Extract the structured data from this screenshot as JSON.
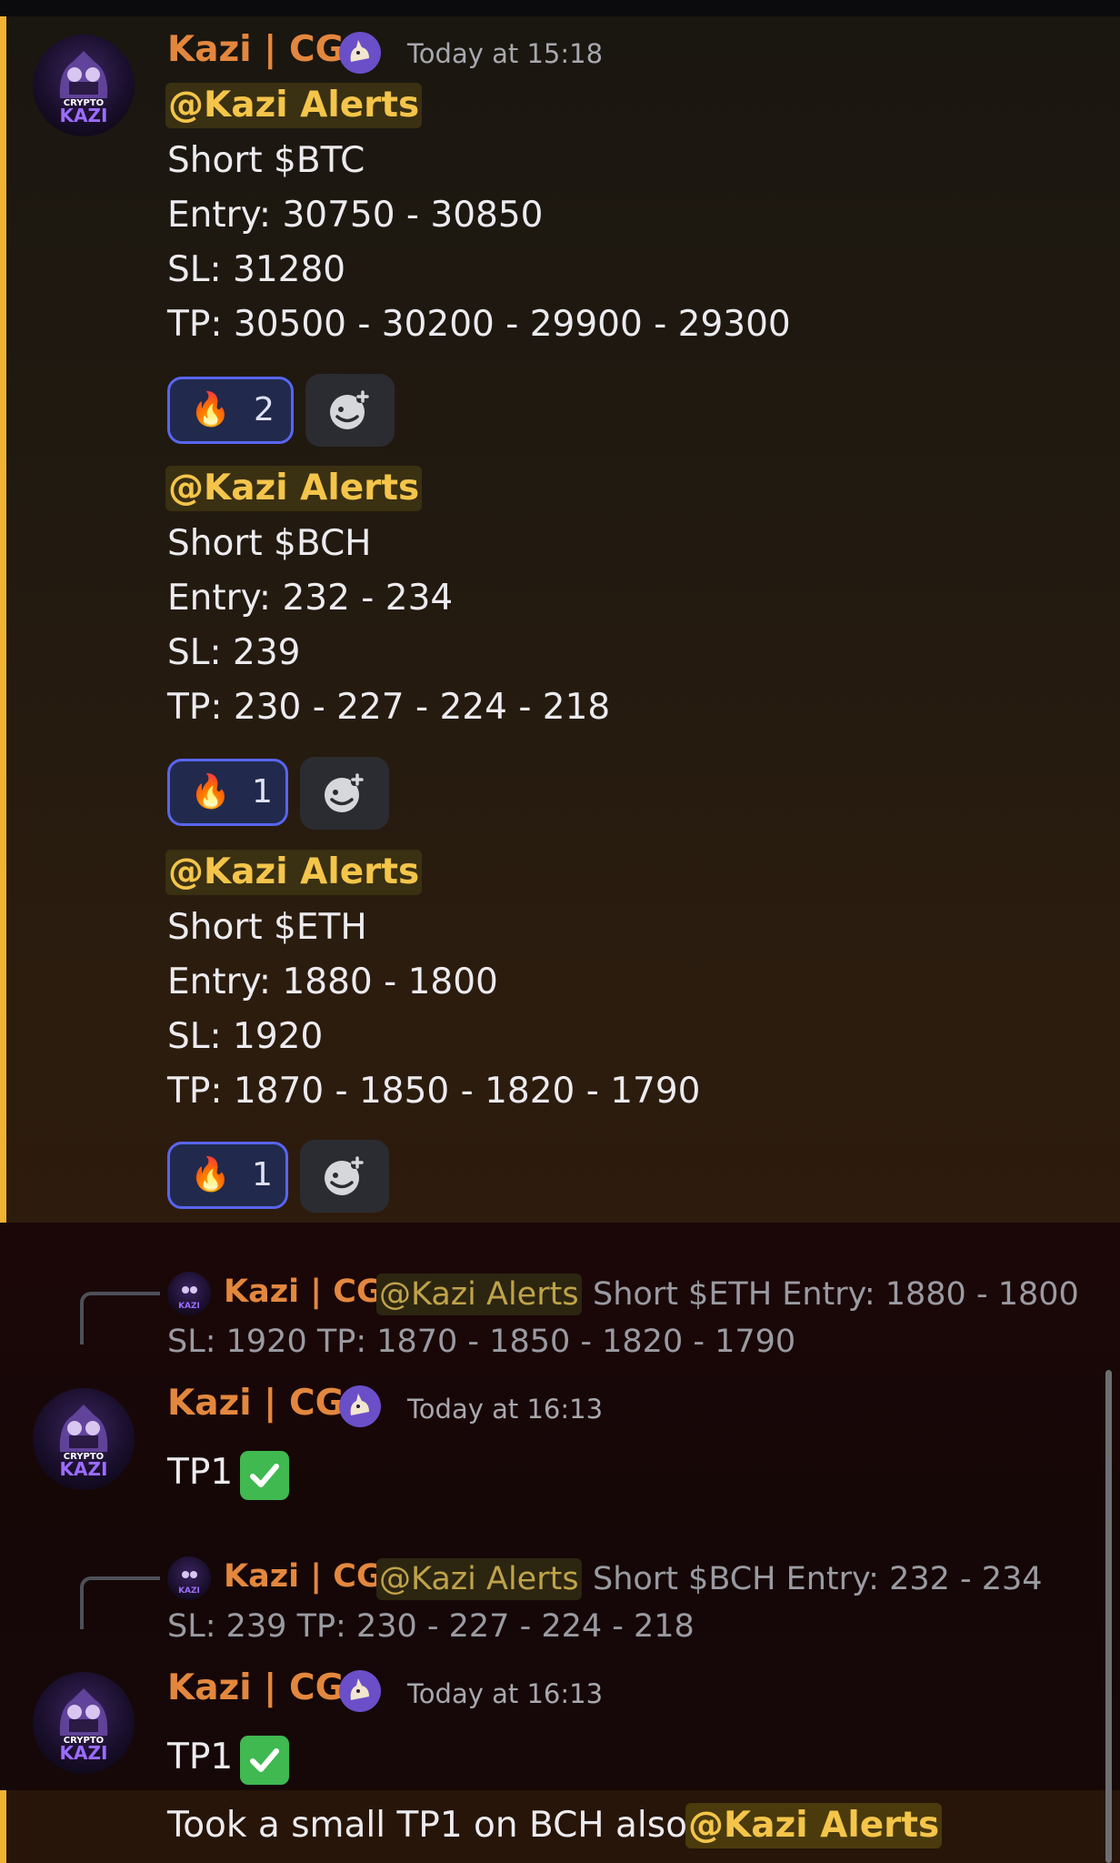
{
  "msg1": {
    "author": "Kazi | CG",
    "timestamp": "Today at 15:18",
    "avatar_text": "CRYPTO KAZI",
    "badge_icon": "goat-icon"
  },
  "alerts": [
    {
      "mention": "@Kazi Alerts",
      "lines": [
        "Short $BTC",
        "Entry: 30750 - 30850",
        "SL: 31280",
        "TP: 30500 - 30200 - 29900 - 29300"
      ],
      "reaction": {
        "emoji": "🔥",
        "count": "2"
      }
    },
    {
      "mention": "@Kazi Alerts",
      "lines": [
        "Short $BCH",
        "Entry: 232 - 234",
        "SL: 239",
        "TP: 230 - 227 - 224 - 218"
      ],
      "reaction": {
        "emoji": "🔥",
        "count": "1"
      }
    },
    {
      "mention": "@Kazi Alerts",
      "lines": [
        "Short $ETH",
        "Entry: 1880 - 1800",
        "SL: 1920",
        "TP: 1870 - 1850 - 1820 - 1790"
      ],
      "reaction": {
        "emoji": "🔥",
        "count": "1"
      }
    }
  ],
  "replies": [
    {
      "ref_author": "Kazi | CG",
      "ref_mention": "@Kazi Alerts",
      "ref_text1": "Short $ETH  Entry: 1880 - 1800",
      "ref_text2": "SL: 1920  TP: 1870 - 1850 - 1820 - 1790",
      "author": "Kazi | CG",
      "timestamp": "Today at 16:13",
      "text": "TP1"
    },
    {
      "ref_author": "Kazi | CG",
      "ref_mention": "@Kazi Alerts",
      "ref_text1": "Short $BCH  Entry: 232 - 234",
      "ref_text2": "SL: 239  TP: 230 - 227 - 224 - 218",
      "author": "Kazi | CG",
      "timestamp": "Today at 16:13",
      "text": "TP1"
    }
  ],
  "last": {
    "text": "Took a small TP1 on BCH also",
    "mention": "@Kazi Alerts"
  },
  "colors": {
    "highlight_bar": "#f0b232",
    "author": "#e3873e",
    "mention": "#f4c54a",
    "reaction_border": "#5865f2"
  }
}
